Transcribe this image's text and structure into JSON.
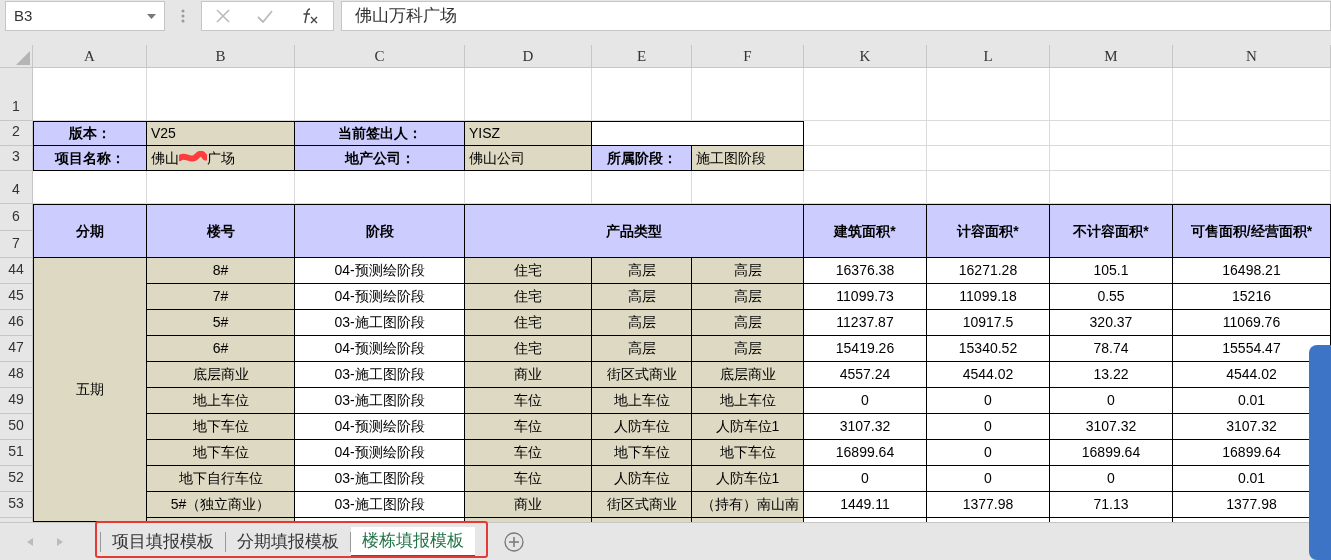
{
  "formula_bar": {
    "name_box": "B3",
    "formula": "佛山万科广场"
  },
  "columns": [
    "A",
    "B",
    "C",
    "D",
    "E",
    "F",
    "K",
    "L",
    "M",
    "N"
  ],
  "row_numbers": [
    "1",
    "2",
    "3",
    "4",
    "6",
    "7",
    "44",
    "45",
    "46",
    "47",
    "48",
    "49",
    "50",
    "51",
    "52",
    "53"
  ],
  "info_rows": [
    [
      {
        "kind": "label",
        "text": "版本："
      },
      {
        "kind": "value",
        "text": "V25"
      },
      {
        "kind": "label",
        "text": "当前签出人："
      },
      {
        "kind": "value",
        "text": "YISZ"
      }
    ],
    [
      {
        "kind": "label",
        "text": "项目名称："
      },
      {
        "kind": "value",
        "parts": [
          "佛山",
          "广场"
        ],
        "redacted": true
      },
      {
        "kind": "label",
        "text": "地产公司："
      },
      {
        "kind": "value",
        "text": "佛山公司"
      },
      {
        "kind": "label",
        "text": "所属阶段："
      },
      {
        "kind": "value",
        "text": "施工图阶段"
      }
    ]
  ],
  "headers": [
    "分期",
    "楼号",
    "阶段",
    "产品类型",
    "建筑面积*",
    "计容面积*",
    "不计容面积*",
    "可售面积/经营面积*"
  ],
  "phase": "五期",
  "rows": [
    [
      "8#",
      "04-预测绘阶段",
      "住宅",
      "高层",
      "高层",
      "16376.38",
      "16271.28",
      "105.1",
      "16498.21"
    ],
    [
      "7#",
      "04-预测绘阶段",
      "住宅",
      "高层",
      "高层",
      "11099.73",
      "11099.18",
      "0.55",
      "15216"
    ],
    [
      "5#",
      "03-施工图阶段",
      "住宅",
      "高层",
      "高层",
      "11237.87",
      "10917.5",
      "320.37",
      "11069.76"
    ],
    [
      "6#",
      "04-预测绘阶段",
      "住宅",
      "高层",
      "高层",
      "15419.26",
      "15340.52",
      "78.74",
      "15554.47"
    ],
    [
      "底层商业",
      "03-施工图阶段",
      "商业",
      "街区式商业",
      "底层商业",
      "4557.24",
      "4544.02",
      "13.22",
      "4544.02"
    ],
    [
      "地上车位",
      "03-施工图阶段",
      "车位",
      "地上车位",
      "地上车位",
      "0",
      "0",
      "0",
      "0.01"
    ],
    [
      "地下车位",
      "04-预测绘阶段",
      "车位",
      "人防车位",
      "人防车位1",
      "3107.32",
      "0",
      "3107.32",
      "3107.32"
    ],
    [
      "地下车位",
      "04-预测绘阶段",
      "车位",
      "地下车位",
      "地下车位",
      "16899.64",
      "0",
      "16899.64",
      "16899.64"
    ],
    [
      "地下自行车位",
      "03-施工图阶段",
      "车位",
      "人防车位",
      "人防车位1",
      "0",
      "0",
      "0",
      "0.01"
    ],
    [
      "5#（独立商业）",
      "03-施工图阶段",
      "商业",
      "街区式商业",
      "（持有）南山南",
      "1449.11",
      "1377.98",
      "71.13",
      "1377.98"
    ]
  ],
  "sheet_tabs": [
    {
      "label": "项目填报模板",
      "selected": false
    },
    {
      "label": "分期填报模板",
      "selected": false
    },
    {
      "label": "楼栋填报模板",
      "selected": true
    }
  ]
}
